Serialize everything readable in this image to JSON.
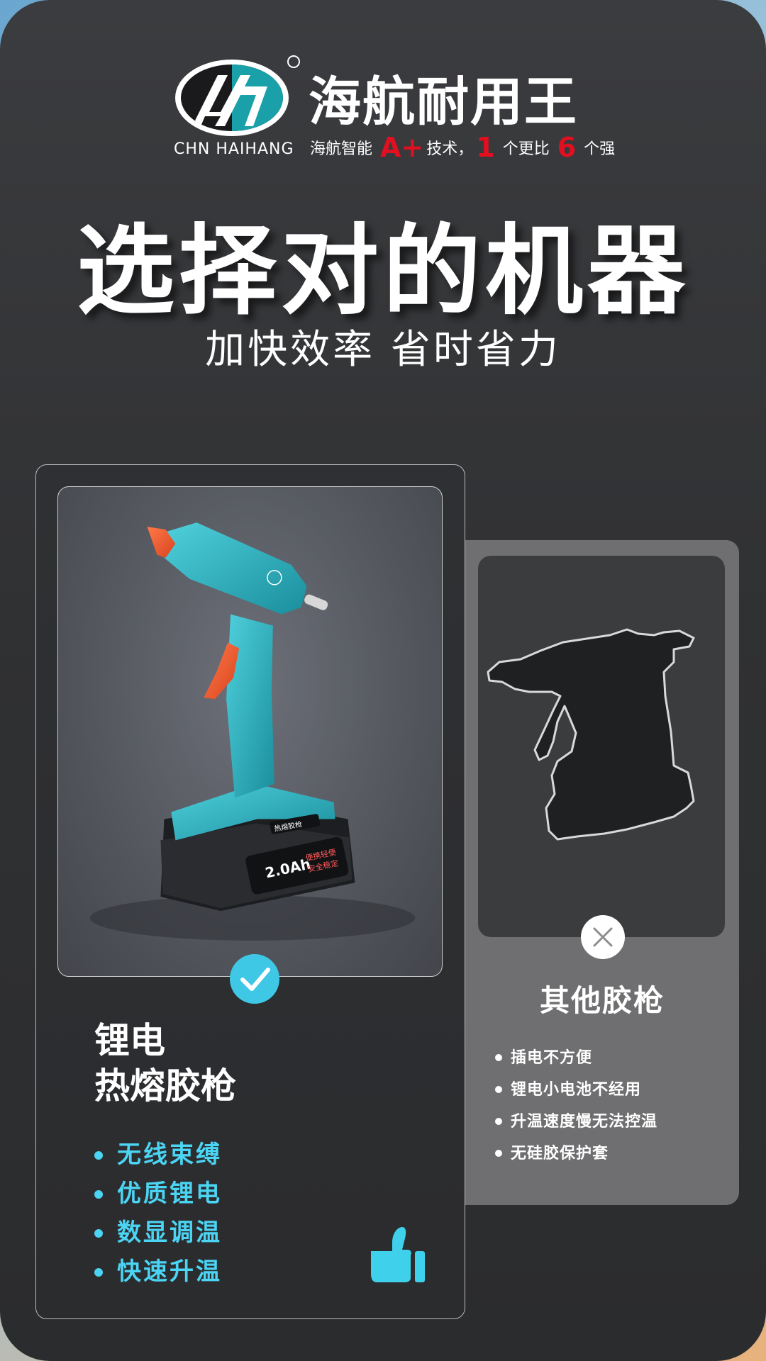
{
  "brand": {
    "name": "海航耐用王",
    "latin_name": "CHN HAIHANG",
    "tagline_parts": [
      "海航智能 ",
      "A+",
      "技术，",
      "1",
      " 个更比 ",
      "6",
      " 个强"
    ],
    "accent_color": "#e10f1f"
  },
  "hero": {
    "title": "选择对的机器",
    "subtitle": "加快效率 省时省力"
  },
  "left_card": {
    "title_line1": "锂电",
    "title_line2": "热熔胶枪",
    "features": [
      "无线束缚",
      "优质锂电",
      "数显调温",
      "快速升温"
    ],
    "feature_color": "#4bd4f3",
    "status_icon": "check-icon",
    "product_labels": {
      "battery_capacity": "2.0Ah",
      "battery_slogan_1": "便携轻便",
      "battery_slogan_2": "安全稳定",
      "body_label": "热熔胶枪"
    }
  },
  "right_card": {
    "title": "其他胶枪",
    "cons": [
      "插电不方便",
      "锂电小电池不经用",
      "升温速度慢无法控温",
      "无硅胶保护套"
    ],
    "status_icon": "close-icon"
  },
  "colors": {
    "background": "#303133",
    "teal": "#3fc7e6",
    "card_right_bg": "#6f6f71"
  }
}
